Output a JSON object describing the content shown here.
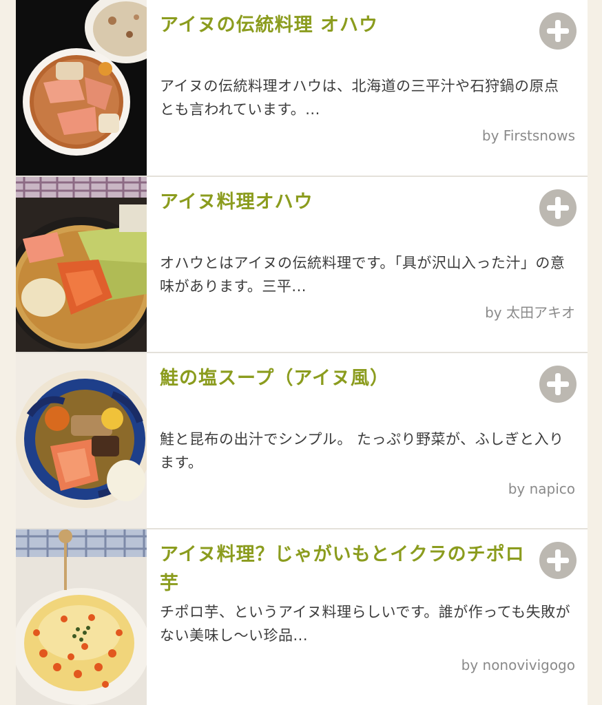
{
  "recipes": [
    {
      "title": "アイヌの伝統料理 オハウ",
      "description": "アイヌの伝統料理オハウは、北海道の三平汁や石狩鍋の原点とも言われています。...",
      "author": "by Firstsnows",
      "add_icon": "plus-circle-icon"
    },
    {
      "title": "アイヌ料理オハウ",
      "description": "オハウとはアイヌの伝統料理です。「具が沢山入った汁」の意味があります。三平...",
      "author": "by 太田アキオ",
      "add_icon": "plus-circle-icon"
    },
    {
      "title": "鮭の塩スープ（アイヌ風）",
      "description": "鮭と昆布の出汁でシンプル。 たっぷり野菜が、ふしぎと入ります。",
      "author": "by napico",
      "add_icon": "plus-circle-icon"
    },
    {
      "title": "アイヌ料理？じゃがいもとイクラのチポロ芋",
      "description": "チポロ芋、というアイヌ料理らしいです。誰が作っても失敗がない美味し〜い珍品...",
      "author": "by nonovivigogo",
      "add_icon": "plus-circle-icon"
    }
  ],
  "colors": {
    "title": "#8b9c1e",
    "description": "#3c3c3c",
    "author": "#8a8a8a",
    "add_button": "#bcb8b1",
    "page_background": "#f5f0e6"
  }
}
